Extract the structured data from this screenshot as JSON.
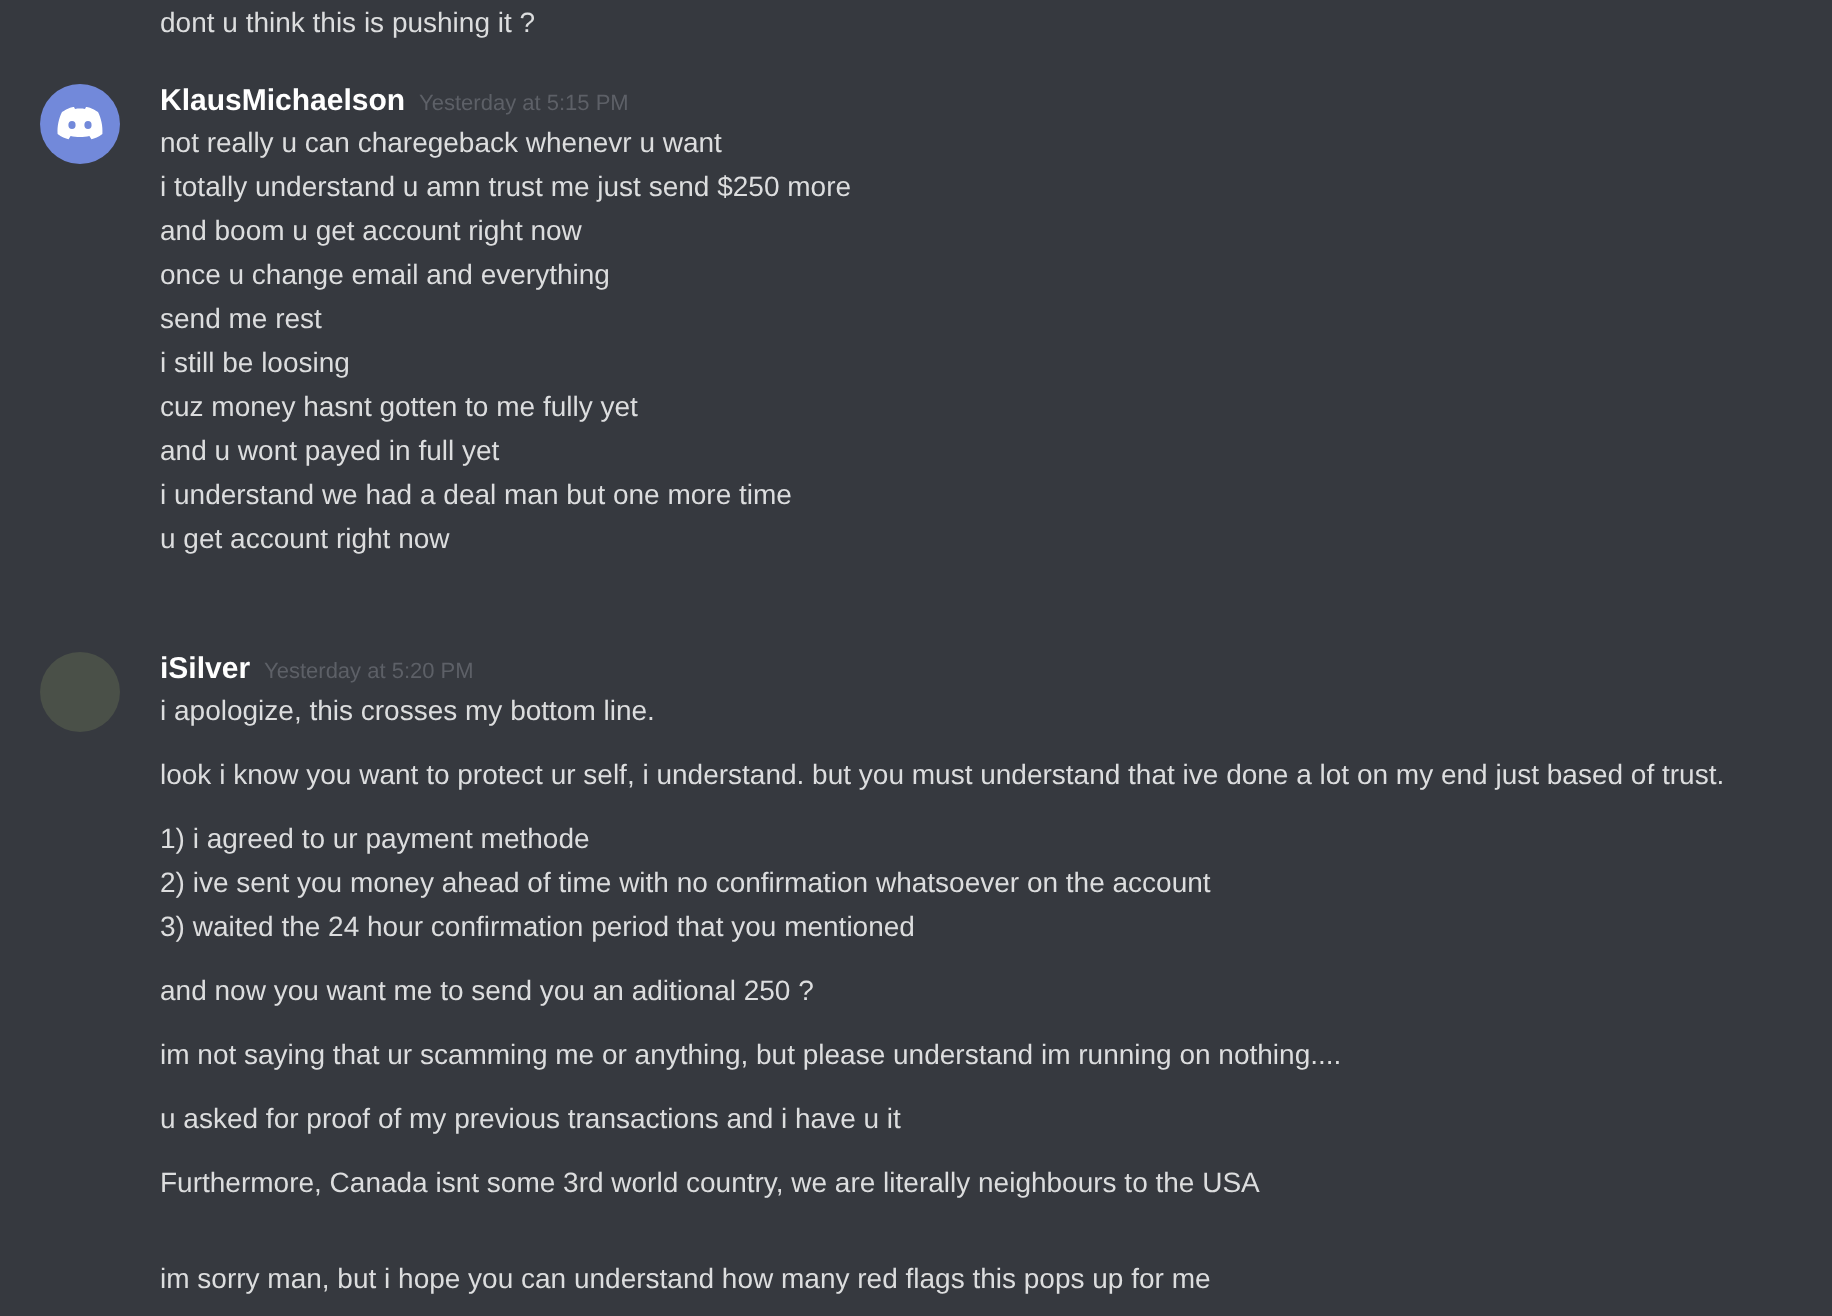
{
  "previous_message_tail": {
    "lines": [
      "dont u think this is pushing it ?"
    ]
  },
  "messages": [
    {
      "author": "KlausMichaelson",
      "timestamp": "Yesterday at 5:15 PM",
      "kind": "default-avatar",
      "blocks": [
        {
          "extra_gap": false,
          "lines": [
            "not really u can charegeback whenevr u want",
            "i totally understand u amn trust me just send $250 more",
            "and boom u get account right now",
            "once u change email and everything",
            "send me rest",
            "i still be loosing",
            "cuz money hasnt gotten to me fully yet",
            "and u wont payed in full yet",
            "i understand we had a deal man but one more time",
            "u get account right now"
          ]
        }
      ]
    },
    {
      "author": "iSilver",
      "timestamp": "Yesterday at 5:20 PM",
      "kind": "photo-avatar",
      "blocks": [
        {
          "extra_gap": false,
          "lines": [
            "i apologize, this crosses my bottom line."
          ]
        },
        {
          "extra_gap": false,
          "lines": [
            "look i know you want to protect ur self, i understand. but you must understand that ive done a lot on my end just based of trust."
          ]
        },
        {
          "extra_gap": false,
          "lines": [
            "1) i agreed to ur payment methode",
            "2) ive sent you money ahead of time with no confirmation whatsoever on the account",
            "3) waited the 24 hour confirmation period that you mentioned"
          ]
        },
        {
          "extra_gap": false,
          "lines": [
            "and now you want me to send you an aditional 250 ?"
          ]
        },
        {
          "extra_gap": false,
          "lines": [
            "im not saying that ur scamming me or anything, but please understand im running on nothing...."
          ]
        },
        {
          "extra_gap": false,
          "lines": [
            "u asked for proof of my previous transactions and i have u it"
          ]
        },
        {
          "extra_gap": false,
          "lines": [
            "Furthermore, Canada isnt some 3rd world country, we are literally neighbours to the USA"
          ]
        },
        {
          "extra_gap": true,
          "lines": [
            "im sorry man, but i hope you can understand how many red flags this pops up for me"
          ]
        }
      ]
    }
  ]
}
